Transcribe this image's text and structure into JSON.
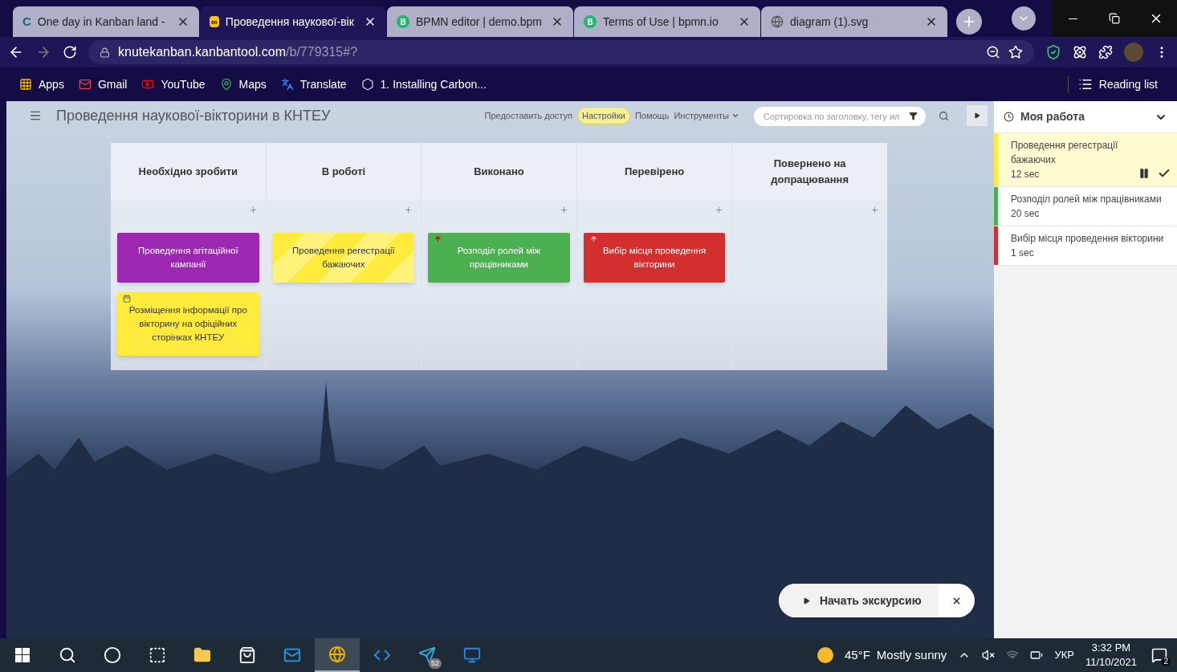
{
  "browser": {
    "tabs": [
      {
        "title": "One day in Kanban land -",
        "selected": false,
        "favicon": "C"
      },
      {
        "title": "Проведення наукової-вік",
        "selected": true,
        "favicon": "∞"
      },
      {
        "title": "BPMN editor | demo.bpm",
        "selected": false,
        "favicon": "B"
      },
      {
        "title": "Terms of Use | bpmn.io",
        "selected": false,
        "favicon": "B"
      },
      {
        "title": "diagram (1).svg",
        "selected": false
      }
    ],
    "address": {
      "host": "knutekanban.kanbantool.com",
      "path": "/b/779315#?"
    },
    "bookmarks": [
      {
        "label": "Apps"
      },
      {
        "label": "Gmail"
      },
      {
        "label": "YouTube"
      },
      {
        "label": "Maps"
      },
      {
        "label": "Translate"
      },
      {
        "label": "1. Installing Carbon..."
      }
    ],
    "reading_list": "Reading list"
  },
  "board": {
    "title": "Проведення наукової-вікторини в КНТЕУ",
    "links": [
      {
        "label": "Предоставить доступ",
        "selected": false,
        "dropdown": false
      },
      {
        "label": "Настройки",
        "selected": true,
        "dropdown": false
      },
      {
        "label": "Помощь",
        "selected": false,
        "dropdown": false
      },
      {
        "label": "Инструменты",
        "selected": false,
        "dropdown": true
      }
    ],
    "search": {
      "placeholder": "Сортировка по заголовку, тегу ил"
    },
    "columns": [
      {
        "title": "Необхідно зробити",
        "cards": [
          {
            "text": "Проведення агітаційної кампанії",
            "color": "#9c27b0",
            "striped": false,
            "priority": false,
            "due_date": false
          },
          {
            "text": "Розміщення інформації про вікторину на офіційних сторінках КНТЕУ",
            "color": "#ffeb3b",
            "striped": false,
            "priority": false,
            "due_date": true
          }
        ]
      },
      {
        "title": "В роботі",
        "cards": [
          {
            "text": "Проведення регестрації бажаючих",
            "color": "#ffeb3b",
            "striped": true,
            "priority": false,
            "due_date": false
          }
        ]
      },
      {
        "title": "Виконано",
        "cards": [
          {
            "text": "Розподіл ролей між працівниками",
            "color": "#4caf50",
            "striped": false,
            "priority": true,
            "due_date": false
          }
        ]
      },
      {
        "title": "Перевірено",
        "cards": [
          {
            "text": "Вибір місця проведення вікторини",
            "color": "#d32f2f",
            "striped": false,
            "priority": true,
            "due_date": false
          }
        ]
      },
      {
        "title": "Повернено на допрацювання"
      }
    ]
  },
  "my_work": {
    "title": "Моя работа",
    "items": [
      {
        "title": "Проведення регестрації бажаючих",
        "time": "12 sec",
        "color": "#ffeb3b",
        "active": true
      },
      {
        "title": "Розподіл ролей між працівниками",
        "time": "20 sec",
        "color": "#4caf50",
        "active": false
      },
      {
        "title": "Вибір місця проведення вікторини",
        "time": "1 sec",
        "color": "#d32f2f",
        "active": false
      }
    ]
  },
  "tour": {
    "label": "Начать экскурсию"
  },
  "taskbar": {
    "apps": [
      {
        "selected": false
      },
      {
        "selected": false
      },
      {
        "selected": false
      },
      {
        "selected": false
      },
      {
        "selected": false
      },
      {
        "selected": false
      },
      {
        "selected": true
      },
      {
        "selected": false
      },
      {
        "selected": false,
        "badge": "52"
      },
      {
        "selected": false
      }
    ],
    "weather": {
      "temp": "45°F",
      "text": "Mostly sunny"
    },
    "language": "УКР",
    "time": "3:32 PM",
    "date": "11/10/2021",
    "notifications": "2"
  }
}
